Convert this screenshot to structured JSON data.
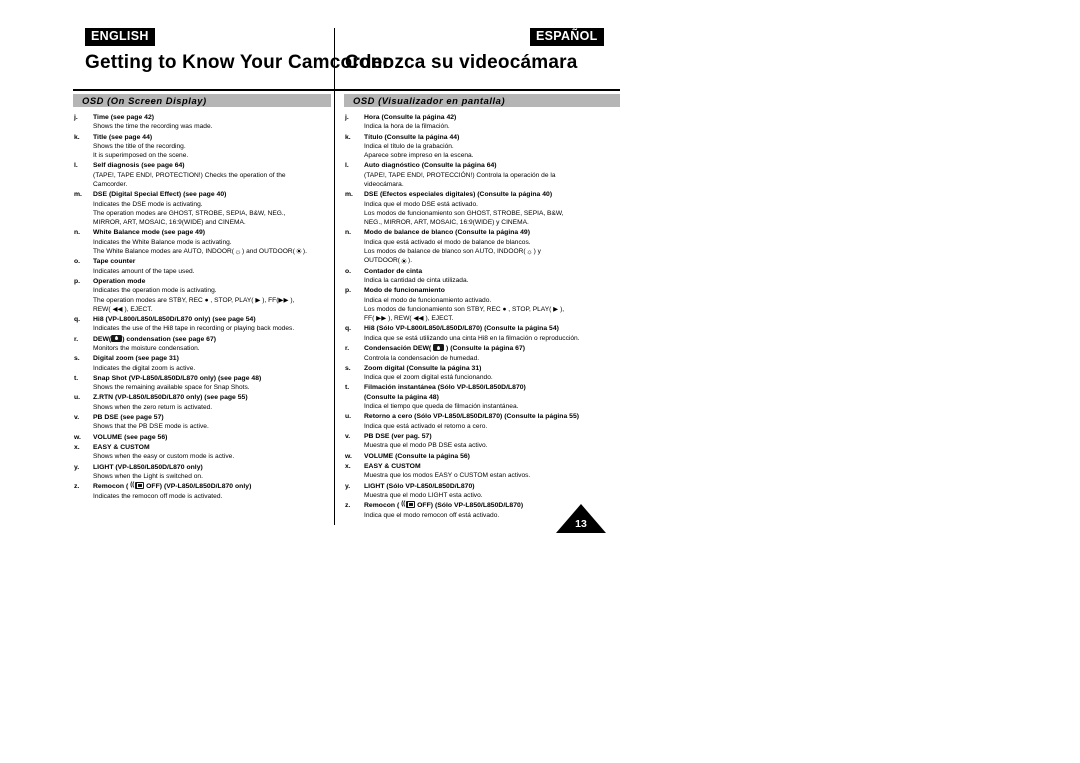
{
  "header": {
    "lang_left": "ENGLISH",
    "lang_right": "ESPAÑOL",
    "title_left": "Getting to Know  Your Camcorder",
    "title_right": "Conozca su videocámara"
  },
  "sections": {
    "left_bar": "OSD (On Screen Display)",
    "right_bar": "OSD (Visualizador en pantalla)"
  },
  "page_number": "13",
  "left_items": [
    {
      "marker": "j.",
      "head": "Time (see page 42)",
      "lines": [
        "Shows the time the recording was made."
      ]
    },
    {
      "marker": "k.",
      "head": "Title (see page 44)",
      "lines": [
        "Shows the title of the recording.",
        "It is superimposed on the scene."
      ]
    },
    {
      "marker": "l.",
      "head": "Self diagnosis (see page 64)",
      "lines": [
        "(TAPE!, TAPE END!, PROTECTION!) Checks the operation of the",
        "Camcorder."
      ]
    },
    {
      "marker": "m.",
      "head": "DSE (Digital Special Effect) (see page 40)",
      "lines": [
        "Indicates the DSE mode is activating.",
        "The operation modes are GHOST, STROBE, SEPIA, B&W, NEG.,",
        "MIRROR, ART, MOSAIC, 16:9(WIDE) and CINEMA."
      ]
    },
    {
      "marker": "n.",
      "head": "White Balance mode (see page 49)",
      "lines": [
        "Indicates the White Balance mode is activating."
      ],
      "special": "wb_en",
      "special_prefix": "The White Balance modes are AUTO, INDOOR(",
      "special_mid": ") and OUTDOOR(",
      "special_suffix": ")."
    },
    {
      "marker": "o.",
      "head": "Tape counter",
      "lines": [
        "Indicates amount of the tape used."
      ]
    },
    {
      "marker": "p.",
      "head": "Operation mode",
      "lines": [
        "Indicates the operation mode is activating."
      ],
      "special": "opmode_en",
      "op_line1": "The operation modes are STBY, REC ● , STOP, PLAY( ▶ ), FF(▶▶ ),",
      "op_line2": "REW( ◀◀ ), EJECT."
    },
    {
      "marker": "q.",
      "head": "Hi8 (VP-L800/L850/L850D/L870 only) (see page 54)",
      "lines": [
        "Indicates the use of the Hi8 tape in recording or playing back modes."
      ]
    },
    {
      "marker": "r.",
      "head": "DEW(",
      "special": "dew_en",
      "head_suffix": ") condensation (see page 67)",
      "lines": [
        "Monitors the moisture condensation."
      ]
    },
    {
      "marker": "s.",
      "head": "Digital zoom (see page 31)",
      "lines": [
        "Indicates the digital zoom is active."
      ]
    },
    {
      "marker": "t.",
      "head": "Snap Shot (VP-L850/L850D/L870 only) (see page 48)",
      "lines": [
        "Shows the remaining available space for Snap Shots."
      ]
    },
    {
      "marker": "u.",
      "head": "Z.RTN (VP-L850/L850D/L870 only) (see page 55)",
      "lines": [
        "Shows when the zero return is activated."
      ]
    },
    {
      "marker": "v.",
      "head": "PB DSE (see page 57)",
      "lines": [
        "Shows that the PB DSE mode is active."
      ]
    },
    {
      "marker": "w.",
      "head": "VOLUME (see page 56)",
      "lines": []
    },
    {
      "marker": "x.",
      "head": "EASY & CUSTOM",
      "lines": [
        "Shows when the easy or custom mode is active."
      ]
    },
    {
      "marker": "y.",
      "head": "LIGHT (VP-L850/L850D/L870 only)",
      "lines": [
        "Shows when the Light is switched on."
      ]
    },
    {
      "marker": "z.",
      "head": "Remocon ( ",
      "special": "remocon_en",
      "head_suffix": " OFF) (VP-L850/L850D/L870 only)",
      "lines": [
        "Indicates the remocon off mode is activated."
      ]
    }
  ],
  "right_items": [
    {
      "marker": "j.",
      "head": "Hora (Consulte la página 42)",
      "lines": [
        "Indica la hora de la filmación."
      ]
    },
    {
      "marker": "k.",
      "head": "Título (Consulte la página 44)",
      "lines": [
        "Indica el título de la grabación.",
        "Aparece sobre impreso en la escena."
      ]
    },
    {
      "marker": "l.",
      "head": "Auto diagnóstico (Consulte la página 64)",
      "lines": [
        "(TAPE!, TAPE END!, PROTECCIÓN!) Controla la operación de la",
        "videocámara."
      ]
    },
    {
      "marker": "m.",
      "head": "DSE (Efectos especiales digitales) (Consulte la página 40)",
      "lines": [
        "Indica que el modo DSE está activado.",
        "Los modos de funcionamiento son GHOST, STROBE, SEPIA, B&W,",
        "NEG., MIRROR, ART, MOSAIC, 16:9(WIDE) y CINEMA."
      ]
    },
    {
      "marker": "n.",
      "head": "Modo de balance de blanco (Consulte la página 49)",
      "lines": [
        "Indica que está activado el modo de balance de blancos."
      ],
      "special": "wb_es",
      "special_prefix": "Los modos de balance de blanco son AUTO, INDOOR(",
      "special_mid": ") y",
      "special_suffix2": "OUTDOOR(",
      "special_suffix": ")."
    },
    {
      "marker": "o.",
      "head": "Contador de cinta",
      "lines": [
        "Indica la cantidad de cinta utilizada."
      ]
    },
    {
      "marker": "p.",
      "head": "Modo de funcionamiento",
      "lines": [
        "Indica el modo de funcionamiento activado."
      ],
      "special": "opmode_es",
      "op_line1": "Los modos de funcionamiento son STBY, REC ● , STOP, PLAY( ▶ ),",
      "op_line2": "FF( ▶▶ ), REW( ◀◀ ), EJECT."
    },
    {
      "marker": "q.",
      "head": "Hi8  (Sólo VP-L800/L850/L850D/L870) (Consulte la página 54)",
      "lines": [
        "Indica que se está utilizando una cinta Hi8 en la filmación o reproducción."
      ]
    },
    {
      "marker": "r.",
      "head": "Condensación DEW( ",
      "special": "dew_es",
      "head_suffix": " ) (Consulte la página 67)",
      "lines": [
        "Controla la condensación de humedad."
      ]
    },
    {
      "marker": "s.",
      "head": "Zoom digital (Consulte la página 31)",
      "lines": [
        "Indica que el zoom digital está funcionando."
      ]
    },
    {
      "marker": "t.",
      "head": "Filmación instantánea (Sólo VP-L850/L850D/L870)",
      "head2": "(Consulte la página 48)",
      "lines": [
        "Indica el tiempo que queda de filmación instantánea."
      ]
    },
    {
      "marker": "u.",
      "head": "Retorno a cero (Sólo VP-L850/L850D/L870) (Consulte la página 55)",
      "lines": [
        "Indica que está activado el retorno a cero."
      ]
    },
    {
      "marker": "v.",
      "head": "PB DSE (ver pag. 57)",
      "lines": [
        "Muestra que el modo PB DSE esta activo."
      ]
    },
    {
      "marker": "w.",
      "head": "VOLUME (Consulte la página 56)",
      "lines": []
    },
    {
      "marker": "x.",
      "head": "EASY & CUSTOM",
      "lines": [
        "Muestra que los modos EASY o CUSTOM estan activos."
      ]
    },
    {
      "marker": "y.",
      "head": "LIGHT (Sólo VP-L850/L850D/L870)",
      "lines": [
        "Muestra que el modo LIGHT esta activo."
      ]
    },
    {
      "marker": "z.",
      "head": "Remocon ( ",
      "special": "remocon_es",
      "head_suffix": " OFF) (Sólo VP-L850/L850D/L870)",
      "lines": [
        "Indica que el modo remocon off está activado."
      ]
    }
  ],
  "icons": {
    "sun": "☀",
    "bulb": "☼",
    "wave": "((",
    "rec_dot": "●",
    "play": "▶",
    "ff": "▶▶",
    "rew": "◀◀"
  },
  "colors": {
    "bar_gray": "#b5b5b5",
    "ink": "#000000",
    "paper": "#ffffff"
  }
}
